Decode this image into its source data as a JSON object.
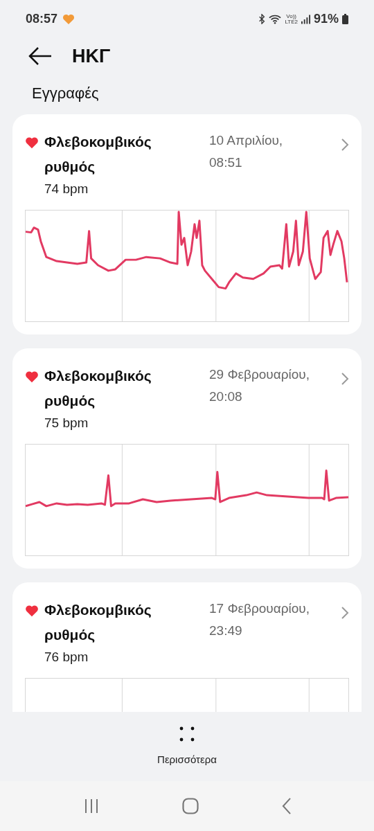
{
  "status_bar": {
    "time": "08:57",
    "volte_top": "Vo))",
    "volte_bottom": "LTE2",
    "battery": "91%"
  },
  "header": {
    "title": "ΗΚΓ"
  },
  "section_title": "Εγγραφές",
  "records": [
    {
      "title": "Φλεβοκομβικός ρυθμός",
      "date_line1": "10 Απριλίου,",
      "date_line2": "08:51",
      "bpm": "74 bpm"
    },
    {
      "title": "Φλεβοκομβικός ρυθμός",
      "date_line1": "29 Φεβρουαρίου,",
      "date_line2": "20:08",
      "bpm": "75 bpm"
    },
    {
      "title": "Φλεβοκομβικός ρυθμός",
      "date_line1": "17 Φεβρουαρίου,",
      "date_line2": "23:49",
      "bpm": "76 bpm"
    }
  ],
  "bottom_action": {
    "label": "Περισσότερα"
  }
}
